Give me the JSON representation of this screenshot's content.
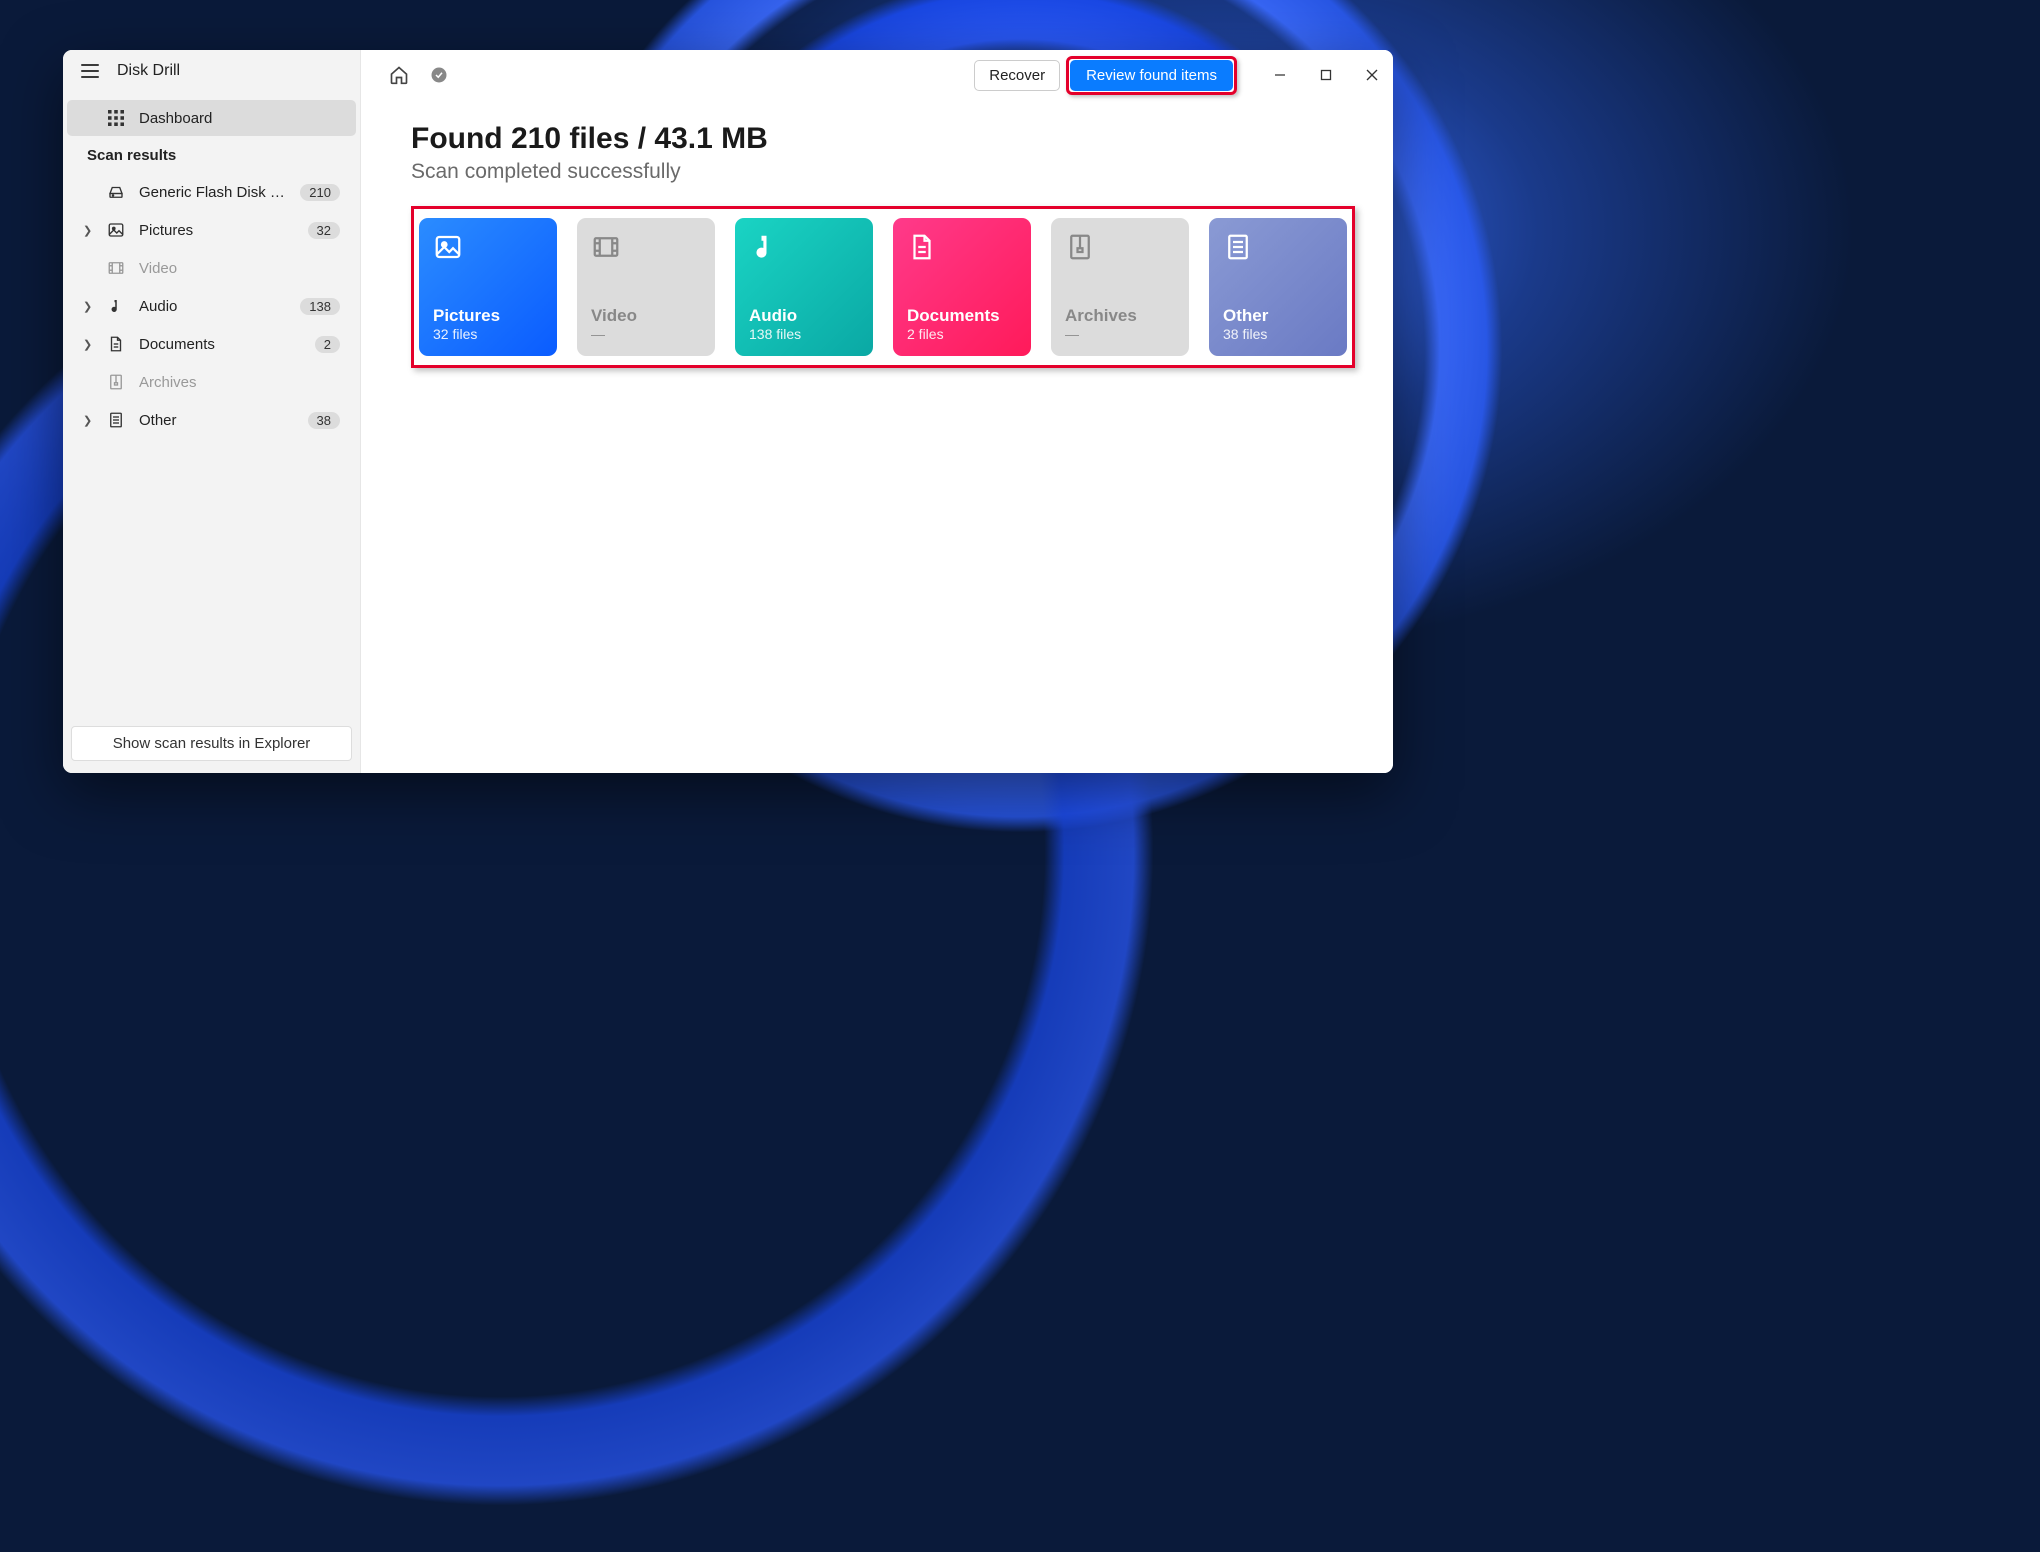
{
  "app_title": "Disk Drill",
  "sidebar": {
    "dashboard": "Dashboard",
    "section": "Scan results",
    "items": [
      {
        "label": "Generic Flash Disk USB…",
        "badge": "210",
        "expandable": false,
        "icon": "drive"
      },
      {
        "label": "Pictures",
        "badge": "32",
        "expandable": true,
        "icon": "picture"
      },
      {
        "label": "Video",
        "badge": "",
        "expandable": false,
        "icon": "video",
        "muted": true
      },
      {
        "label": "Audio",
        "badge": "138",
        "expandable": true,
        "icon": "audio"
      },
      {
        "label": "Documents",
        "badge": "2",
        "expandable": true,
        "icon": "document"
      },
      {
        "label": "Archives",
        "badge": "",
        "expandable": false,
        "icon": "archive",
        "muted": true
      },
      {
        "label": "Other",
        "badge": "38",
        "expandable": true,
        "icon": "other"
      }
    ],
    "footer_button": "Show scan results in Explorer"
  },
  "toolbar": {
    "recover": "Recover",
    "review": "Review found items"
  },
  "heading": "Found 210 files / 43.1 MB",
  "subheading": "Scan completed successfully",
  "categories": [
    {
      "title": "Pictures",
      "count": "32 files",
      "style": "g-blue",
      "icon": "picture"
    },
    {
      "title": "Video",
      "count": "—",
      "style": "disabled",
      "icon": "video"
    },
    {
      "title": "Audio",
      "count": "138 files",
      "style": "g-teal",
      "icon": "audio"
    },
    {
      "title": "Documents",
      "count": "2 files",
      "style": "g-pink",
      "icon": "document"
    },
    {
      "title": "Archives",
      "count": "—",
      "style": "disabled",
      "icon": "archive"
    },
    {
      "title": "Other",
      "count": "38 files",
      "style": "g-purple",
      "icon": "other"
    }
  ]
}
